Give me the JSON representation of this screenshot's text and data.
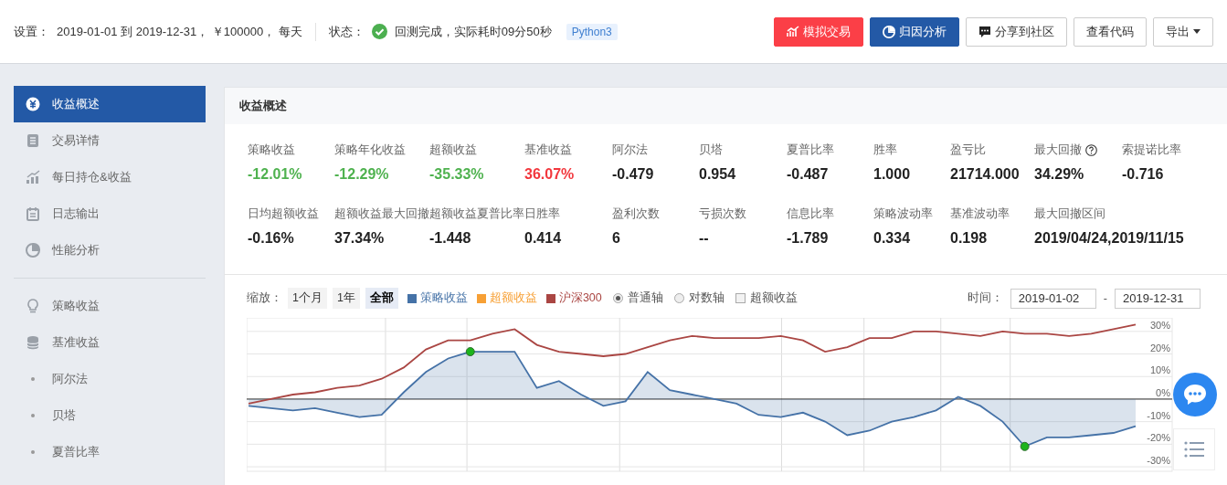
{
  "topbar": {
    "settings_label": "设置：",
    "settings": "2019-01-01 到 2019-12-31， ￥100000， 每天",
    "status_label": "状态：",
    "status_ok": true,
    "status": "回测完成，实际耗时09分50秒",
    "tag": "Python3",
    "buttons": [
      {
        "label": "模拟交易",
        "kind": "danger"
      },
      {
        "label": "归因分析",
        "kind": "primary"
      },
      {
        "label": "分享到社区",
        "kind": "default"
      },
      {
        "label": "查看代码",
        "kind": "default"
      },
      {
        "label": "导出",
        "kind": "dropdown"
      }
    ]
  },
  "sidebar": {
    "groups": [
      [
        {
          "label": "收益概述",
          "kind": "icon",
          "selected": true
        },
        {
          "label": "交易详情",
          "kind": "icon",
          "selected": false
        },
        {
          "label": "每日持仓&收益",
          "kind": "icon",
          "selected": false
        },
        {
          "label": "日志输出",
          "kind": "icon",
          "selected": false
        },
        {
          "label": "性能分析",
          "kind": "icon",
          "selected": false
        }
      ],
      [
        {
          "label": "策略收益",
          "kind": "icon",
          "selected": false
        },
        {
          "label": "基准收益",
          "kind": "icon",
          "selected": false
        },
        {
          "label": "阿尔法",
          "kind": "bullet",
          "selected": false
        },
        {
          "label": "贝塔",
          "kind": "bullet",
          "selected": false
        },
        {
          "label": "夏普比率",
          "kind": "bullet",
          "selected": false
        }
      ]
    ]
  },
  "panel": {
    "title": "收益概述",
    "metrics": [
      [
        {
          "label": "策略收益",
          "value": "-12.01%",
          "color": "#4fb24f"
        },
        {
          "label": "策略年化收益",
          "value": "-12.29%",
          "color": "#4fb24f"
        },
        {
          "label": "超额收益",
          "value": "-35.33%",
          "color": "#4fb24f"
        },
        {
          "label": "基准收益",
          "value": "36.07%",
          "color": "#f2373d"
        },
        {
          "label": "阿尔法",
          "value": "-0.479"
        },
        {
          "label": "贝塔",
          "value": "0.954"
        },
        {
          "label": "夏普比率",
          "value": "-0.487"
        },
        {
          "label": "胜率",
          "value": "1.000"
        },
        {
          "label": "盈亏比",
          "value": "21714.000"
        },
        {
          "label": "最大回撤",
          "value": "34.29%",
          "help": true
        },
        {
          "label": "索提诺比率",
          "value": "-0.716"
        }
      ],
      [
        {
          "label": "日均超额收益",
          "value": "-0.16%"
        },
        {
          "label": "超额收益最大回撤",
          "value": "37.34%"
        },
        {
          "label": "超额收益夏普比率",
          "value": "-1.448"
        },
        {
          "label": "日胜率",
          "value": "0.414"
        },
        {
          "label": "盈利次数",
          "value": "6"
        },
        {
          "label": "亏损次数",
          "value": "--"
        },
        {
          "label": "信息比率",
          "value": "-1.789"
        },
        {
          "label": "策略波动率",
          "value": "0.334"
        },
        {
          "label": "基准波动率",
          "value": "0.198"
        },
        {
          "label": "最大回撤区间",
          "value": "2019/04/24,2019/11/15"
        }
      ]
    ],
    "chart": {
      "zoom_label": "缩放：",
      "zoom": [
        {
          "label": "1个月",
          "selected": false
        },
        {
          "label": "1年",
          "selected": false
        },
        {
          "label": "全部",
          "selected": true
        }
      ],
      "axis_options": [
        {
          "label": "普通轴",
          "selected": true
        },
        {
          "label": "对数轴",
          "selected": false
        }
      ],
      "excess": {
        "label": "超额收益",
        "checked": false
      },
      "time_label": "时间：",
      "start": "2019-01-02",
      "dash": "-",
      "end": "2019-12-31",
      "chart_data": {
        "type": "line",
        "grid": true,
        "series": [
          {
            "name": "策略收益",
            "color": "#4572a7",
            "values": [
              -3,
              -4,
              -5,
              -4,
              -6,
              -8,
              -7,
              3,
              12,
              18,
              21,
              21,
              21,
              5,
              8,
              2,
              -3,
              -1,
              12,
              4,
              2,
              0,
              -2,
              -7,
              -8,
              -6,
              -10,
              -16,
              -14,
              -10,
              -8,
              -5,
              1,
              -3,
              -10,
              -21,
              -17,
              -17,
              -16,
              -15,
              -12
            ]
          },
          {
            "name": "超额收益",
            "color": "#f7a035",
            "values": [
              null,
              null,
              null,
              null,
              null,
              null,
              null,
              null,
              null,
              null,
              null,
              null,
              null,
              null,
              null,
              null,
              null,
              null,
              null,
              null,
              null,
              null,
              null,
              null,
              null,
              null,
              null,
              null,
              null,
              null,
              null,
              null,
              null,
              null,
              null,
              null,
              null,
              null,
              null,
              null,
              null
            ]
          },
          {
            "name": "沪深300",
            "color": "#aa4643",
            "values": [
              -2,
              0,
              2,
              3,
              5,
              6,
              9,
              14,
              22,
              26,
              26,
              29,
              31,
              24,
              21,
              20,
              19,
              20,
              23,
              26,
              28,
              27,
              27,
              27,
              28,
              26,
              21,
              23,
              27,
              27,
              30,
              30,
              29,
              28,
              30,
              29,
              29,
              28,
              29,
              31,
              33
            ]
          }
        ],
        "ylim": [
          -32,
          36
        ],
        "yticks": [
          {
            "value": 30,
            "label": "30%"
          },
          {
            "value": 20,
            "label": "20%"
          },
          {
            "value": 10,
            "label": "10%"
          },
          {
            "value": 0,
            "label": "0%"
          },
          {
            "value": -10,
            "label": "-10%"
          },
          {
            "value": -20,
            "label": "-20%"
          },
          {
            "value": -30,
            "label": "-30%"
          }
        ]
      }
    }
  }
}
